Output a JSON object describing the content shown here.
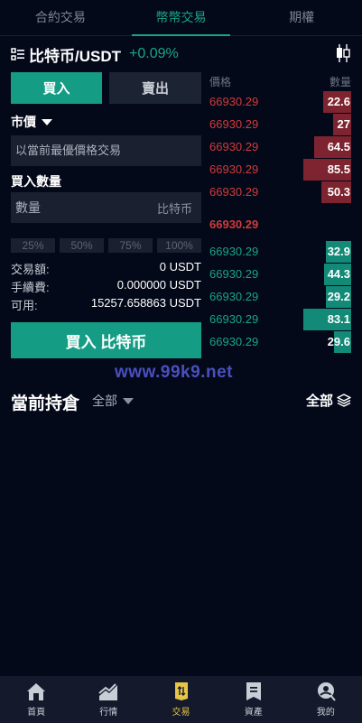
{
  "tabs": [
    {
      "label": "合約交易"
    },
    {
      "label": "幣幣交易"
    },
    {
      "label": "期權"
    }
  ],
  "pair": {
    "name": "比特币/USDT",
    "change": "+0.09%"
  },
  "trade": {
    "buy_tab": "買入",
    "sell_tab": "賣出",
    "order_type": "市價",
    "price_placeholder": "以當前最優價格交易",
    "qty_label": "買入數量",
    "qty_placeholder": "數量",
    "qty_unit": "比特币",
    "percents": [
      "25%",
      "50%",
      "75%",
      "100%"
    ],
    "amount_label": "交易額:",
    "amount_value": "0 USDT",
    "fee_label": "手續費:",
    "fee_value": "0.000000 USDT",
    "avail_label": "可用:",
    "avail_value": "15257.658863 USDT",
    "submit": "買入 比特币"
  },
  "orderbook": {
    "price_header": "價格",
    "qty_header": "數量",
    "asks": [
      {
        "price": "66930.29",
        "qty": "22.6",
        "depth": 0.2
      },
      {
        "price": "66930.29",
        "qty": "27",
        "depth": 0.13
      },
      {
        "price": "66930.29",
        "qty": "64.5",
        "depth": 0.26
      },
      {
        "price": "66930.29",
        "qty": "85.5",
        "depth": 0.34
      },
      {
        "price": "66930.29",
        "qty": "50.3",
        "depth": 0.21
      }
    ],
    "mid_price": "66930.29",
    "bids": [
      {
        "price": "66930.29",
        "qty": "32.9",
        "depth": 0.18
      },
      {
        "price": "66930.29",
        "qty": "44.3",
        "depth": 0.19
      },
      {
        "price": "66930.29",
        "qty": "29.2",
        "depth": 0.18
      },
      {
        "price": "66930.29",
        "qty": "83.1",
        "depth": 0.34
      },
      {
        "price": "66930.29",
        "qty": "29.6",
        "depth": 0.12
      }
    ]
  },
  "watermark": "www.99k9.net",
  "holdings": {
    "title": "當前持倉",
    "filter": "全部",
    "all_label": "全部"
  },
  "nav": [
    {
      "label": "首頁",
      "icon": "home-icon"
    },
    {
      "label": "行情",
      "icon": "chart-icon"
    },
    {
      "label": "交易",
      "icon": "trade-icon"
    },
    {
      "label": "資產",
      "icon": "wallet-icon"
    },
    {
      "label": "我的",
      "icon": "profile-icon"
    }
  ],
  "colors": {
    "accent": "#149c84",
    "ask": "#d03b3b",
    "bid": "#1aa38a",
    "active_nav": "#e8c547"
  }
}
